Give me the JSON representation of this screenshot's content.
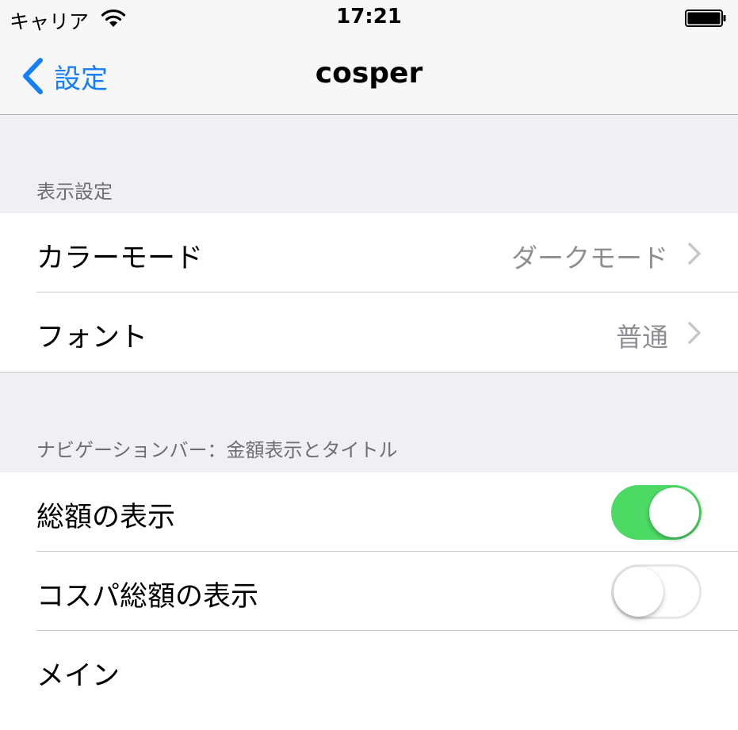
{
  "status_bar": {
    "carrier": "キャリア",
    "time": "17:21"
  },
  "nav": {
    "back_label": "設定",
    "title": "cosper"
  },
  "sections": [
    {
      "header": "表示設定",
      "rows": [
        {
          "label": "カラーモード",
          "value": "ダークモード"
        },
        {
          "label": "フォント",
          "value": "普通"
        }
      ]
    },
    {
      "header": "ナビゲーションバー：金額表示とタイトル",
      "rows": [
        {
          "label": "総額の表示",
          "toggle": true
        },
        {
          "label": "コスパ総額の表示",
          "toggle": false
        },
        {
          "label": "メイン"
        }
      ]
    }
  ],
  "colors": {
    "accent": "#157efb",
    "toggle_on": "#4cd964",
    "background": "#efeff4"
  }
}
